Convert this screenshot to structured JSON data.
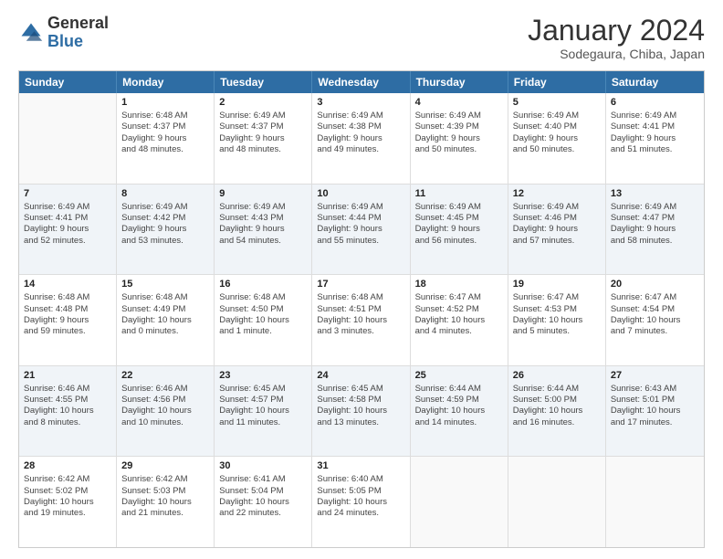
{
  "header": {
    "logo_general": "General",
    "logo_blue": "Blue",
    "title": "January 2024",
    "subtitle": "Sodegaura, Chiba, Japan"
  },
  "calendar": {
    "days": [
      "Sunday",
      "Monday",
      "Tuesday",
      "Wednesday",
      "Thursday",
      "Friday",
      "Saturday"
    ],
    "rows": [
      [
        {
          "day": "",
          "lines": []
        },
        {
          "day": "1",
          "lines": [
            "Sunrise: 6:48 AM",
            "Sunset: 4:37 PM",
            "Daylight: 9 hours",
            "and 48 minutes."
          ]
        },
        {
          "day": "2",
          "lines": [
            "Sunrise: 6:49 AM",
            "Sunset: 4:37 PM",
            "Daylight: 9 hours",
            "and 48 minutes."
          ]
        },
        {
          "day": "3",
          "lines": [
            "Sunrise: 6:49 AM",
            "Sunset: 4:38 PM",
            "Daylight: 9 hours",
            "and 49 minutes."
          ]
        },
        {
          "day": "4",
          "lines": [
            "Sunrise: 6:49 AM",
            "Sunset: 4:39 PM",
            "Daylight: 9 hours",
            "and 50 minutes."
          ]
        },
        {
          "day": "5",
          "lines": [
            "Sunrise: 6:49 AM",
            "Sunset: 4:40 PM",
            "Daylight: 9 hours",
            "and 50 minutes."
          ]
        },
        {
          "day": "6",
          "lines": [
            "Sunrise: 6:49 AM",
            "Sunset: 4:41 PM",
            "Daylight: 9 hours",
            "and 51 minutes."
          ]
        }
      ],
      [
        {
          "day": "7",
          "lines": [
            "Sunrise: 6:49 AM",
            "Sunset: 4:41 PM",
            "Daylight: 9 hours",
            "and 52 minutes."
          ]
        },
        {
          "day": "8",
          "lines": [
            "Sunrise: 6:49 AM",
            "Sunset: 4:42 PM",
            "Daylight: 9 hours",
            "and 53 minutes."
          ]
        },
        {
          "day": "9",
          "lines": [
            "Sunrise: 6:49 AM",
            "Sunset: 4:43 PM",
            "Daylight: 9 hours",
            "and 54 minutes."
          ]
        },
        {
          "day": "10",
          "lines": [
            "Sunrise: 6:49 AM",
            "Sunset: 4:44 PM",
            "Daylight: 9 hours",
            "and 55 minutes."
          ]
        },
        {
          "day": "11",
          "lines": [
            "Sunrise: 6:49 AM",
            "Sunset: 4:45 PM",
            "Daylight: 9 hours",
            "and 56 minutes."
          ]
        },
        {
          "day": "12",
          "lines": [
            "Sunrise: 6:49 AM",
            "Sunset: 4:46 PM",
            "Daylight: 9 hours",
            "and 57 minutes."
          ]
        },
        {
          "day": "13",
          "lines": [
            "Sunrise: 6:49 AM",
            "Sunset: 4:47 PM",
            "Daylight: 9 hours",
            "and 58 minutes."
          ]
        }
      ],
      [
        {
          "day": "14",
          "lines": [
            "Sunrise: 6:48 AM",
            "Sunset: 4:48 PM",
            "Daylight: 9 hours",
            "and 59 minutes."
          ]
        },
        {
          "day": "15",
          "lines": [
            "Sunrise: 6:48 AM",
            "Sunset: 4:49 PM",
            "Daylight: 10 hours",
            "and 0 minutes."
          ]
        },
        {
          "day": "16",
          "lines": [
            "Sunrise: 6:48 AM",
            "Sunset: 4:50 PM",
            "Daylight: 10 hours",
            "and 1 minute."
          ]
        },
        {
          "day": "17",
          "lines": [
            "Sunrise: 6:48 AM",
            "Sunset: 4:51 PM",
            "Daylight: 10 hours",
            "and 3 minutes."
          ]
        },
        {
          "day": "18",
          "lines": [
            "Sunrise: 6:47 AM",
            "Sunset: 4:52 PM",
            "Daylight: 10 hours",
            "and 4 minutes."
          ]
        },
        {
          "day": "19",
          "lines": [
            "Sunrise: 6:47 AM",
            "Sunset: 4:53 PM",
            "Daylight: 10 hours",
            "and 5 minutes."
          ]
        },
        {
          "day": "20",
          "lines": [
            "Sunrise: 6:47 AM",
            "Sunset: 4:54 PM",
            "Daylight: 10 hours",
            "and 7 minutes."
          ]
        }
      ],
      [
        {
          "day": "21",
          "lines": [
            "Sunrise: 6:46 AM",
            "Sunset: 4:55 PM",
            "Daylight: 10 hours",
            "and 8 minutes."
          ]
        },
        {
          "day": "22",
          "lines": [
            "Sunrise: 6:46 AM",
            "Sunset: 4:56 PM",
            "Daylight: 10 hours",
            "and 10 minutes."
          ]
        },
        {
          "day": "23",
          "lines": [
            "Sunrise: 6:45 AM",
            "Sunset: 4:57 PM",
            "Daylight: 10 hours",
            "and 11 minutes."
          ]
        },
        {
          "day": "24",
          "lines": [
            "Sunrise: 6:45 AM",
            "Sunset: 4:58 PM",
            "Daylight: 10 hours",
            "and 13 minutes."
          ]
        },
        {
          "day": "25",
          "lines": [
            "Sunrise: 6:44 AM",
            "Sunset: 4:59 PM",
            "Daylight: 10 hours",
            "and 14 minutes."
          ]
        },
        {
          "day": "26",
          "lines": [
            "Sunrise: 6:44 AM",
            "Sunset: 5:00 PM",
            "Daylight: 10 hours",
            "and 16 minutes."
          ]
        },
        {
          "day": "27",
          "lines": [
            "Sunrise: 6:43 AM",
            "Sunset: 5:01 PM",
            "Daylight: 10 hours",
            "and 17 minutes."
          ]
        }
      ],
      [
        {
          "day": "28",
          "lines": [
            "Sunrise: 6:42 AM",
            "Sunset: 5:02 PM",
            "Daylight: 10 hours",
            "and 19 minutes."
          ]
        },
        {
          "day": "29",
          "lines": [
            "Sunrise: 6:42 AM",
            "Sunset: 5:03 PM",
            "Daylight: 10 hours",
            "and 21 minutes."
          ]
        },
        {
          "day": "30",
          "lines": [
            "Sunrise: 6:41 AM",
            "Sunset: 5:04 PM",
            "Daylight: 10 hours",
            "and 22 minutes."
          ]
        },
        {
          "day": "31",
          "lines": [
            "Sunrise: 6:40 AM",
            "Sunset: 5:05 PM",
            "Daylight: 10 hours",
            "and 24 minutes."
          ]
        },
        {
          "day": "",
          "lines": []
        },
        {
          "day": "",
          "lines": []
        },
        {
          "day": "",
          "lines": []
        }
      ]
    ],
    "alt_rows": [
      1,
      3
    ]
  }
}
